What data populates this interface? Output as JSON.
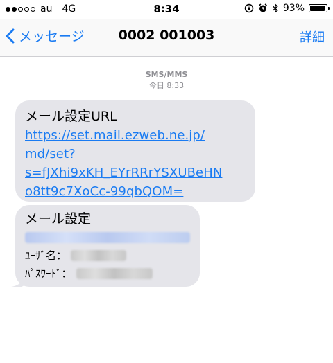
{
  "status_bar": {
    "carrier": "au",
    "network": "4G",
    "time": "8:34",
    "battery_percent": "93%",
    "battery_level": 0.93
  },
  "nav": {
    "back_label": "メッセージ",
    "title": "0002 001003",
    "details_label": "詳細"
  },
  "conversation": {
    "service": "SMS/MMS",
    "timestamp": "今日 8:33"
  },
  "messages": [
    {
      "title": "メール設定URL",
      "link_lines": [
        "https://set.mail.ezweb.ne.jp/",
        "md/set?",
        "s=fJXhi9xKH_EYrRRrYSXUBeHN",
        "o8tt9c7XoCc-99qbQOM="
      ]
    },
    {
      "title": "メール設定",
      "user_label": "ﾕｰｻﾞ名：",
      "password_label": "ﾊﾟｽﾜｰﾄﾞ："
    }
  ],
  "colors": {
    "accent": "#1a7bf2",
    "bubble": "#e5e5ea",
    "meta_text": "#8e8e93"
  }
}
